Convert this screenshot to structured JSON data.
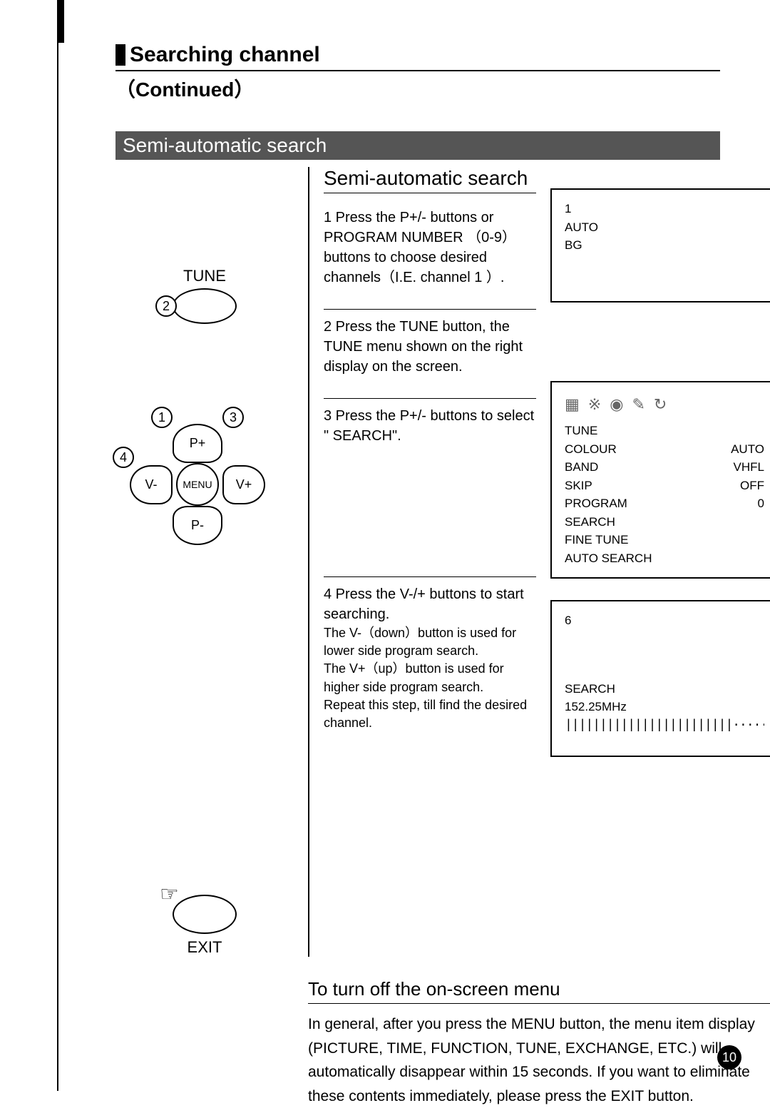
{
  "header": {
    "title": "Searching  channel",
    "subtitle": "（Continued）"
  },
  "section_bar": "Semi-automatic search",
  "sub_heading": "Semi-automatic search",
  "steps": {
    "s1": "1 Press the P+/-  buttons or PROGRAM NUMBER （0-9） buttons to choose desired channels（I.E.   channel 1 ）.",
    "s2": "2 Press the TUNE  button, the TUNE menu shown on the right display on the screen.",
    "s3": "3 Press the P+/- buttons to select \" SEARCH\".",
    "s4_a": "4 Press the V-/+ buttons  to start searching.",
    "s4_b": "The V-（down）button is used for lower side program search.",
    "s4_c": "The V+（up）button is used for higher side  program search.",
    "s4_d": "   Repeat this step, till find the desired channel."
  },
  "remote": {
    "tune_label": "TUNE",
    "step2": "2",
    "dpad": {
      "up": "P+",
      "down": "P-",
      "left": "V-",
      "right": "V+",
      "center": "MENU",
      "n1": "1",
      "n3": "3",
      "n4": "4"
    },
    "exit_label": "EXIT"
  },
  "osd1": {
    "l1": "1",
    "l2": "AUTO",
    "l3": "BG"
  },
  "osd2": {
    "title": "TUNE",
    "rows": [
      {
        "k": "COLOUR",
        "v": "AUTO"
      },
      {
        "k": "BAND",
        "v": "VHFL"
      },
      {
        "k": "SKIP",
        "v": "OFF"
      },
      {
        "k": "PROGRAM",
        "v": "0"
      },
      {
        "k": "SEARCH",
        "v": ""
      },
      {
        "k": "FINE TUNE",
        "v": ""
      },
      {
        "k": "AUTO SEARCH",
        "v": ""
      }
    ]
  },
  "osd3": {
    "num": "6",
    "label": "SEARCH",
    "freq": "152.25MHz",
    "bar": "||||||||||||||||||||||||··········"
  },
  "turnoff": {
    "heading": "To turn off the on-screen menu",
    "body": "In general, after you press the MENU button, the menu item display (PICTURE, TIME, FUNCTION, TUNE, EXCHANGE, ETC.) will automatically  disappear within 15 seconds. If you want to eliminate these contents immediately,  please press the EXIT  button."
  },
  "page_number": "10"
}
